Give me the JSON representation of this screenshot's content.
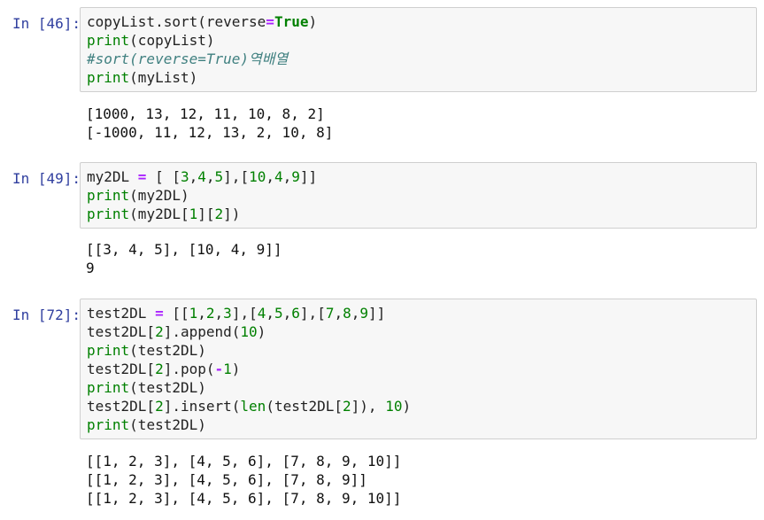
{
  "cells": [
    {
      "prompt": "In [46]:",
      "code": [
        [
          {
            "t": "copyList.sort(reverse"
          },
          {
            "t": "=",
            "c": "op"
          },
          {
            "t": "True",
            "c": "kw"
          },
          {
            "t": ")"
          }
        ],
        [
          {
            "t": "print",
            "c": "bi"
          },
          {
            "t": "(copyList)"
          }
        ],
        [
          {
            "t": "#sort(reverse=True)역배열",
            "c": "cm"
          }
        ],
        [
          {
            "t": "print",
            "c": "bi"
          },
          {
            "t": "(myList)"
          }
        ]
      ],
      "output": [
        "[1000, 13, 12, 11, 10, 8, 2]",
        "[-1000, 11, 12, 13, 2, 10, 8]"
      ]
    },
    {
      "prompt": "In [49]:",
      "code": [
        [
          {
            "t": "my2DL "
          },
          {
            "t": "=",
            "c": "op"
          },
          {
            "t": " [ ["
          },
          {
            "t": "3",
            "c": "num"
          },
          {
            "t": ","
          },
          {
            "t": "4",
            "c": "num"
          },
          {
            "t": ","
          },
          {
            "t": "5",
            "c": "num"
          },
          {
            "t": "],["
          },
          {
            "t": "10",
            "c": "num"
          },
          {
            "t": ","
          },
          {
            "t": "4",
            "c": "num"
          },
          {
            "t": ","
          },
          {
            "t": "9",
            "c": "num"
          },
          {
            "t": "]]"
          }
        ],
        [
          {
            "t": "print",
            "c": "bi"
          },
          {
            "t": "(my2DL)"
          }
        ],
        [
          {
            "t": "print",
            "c": "bi"
          },
          {
            "t": "(my2DL["
          },
          {
            "t": "1",
            "c": "num"
          },
          {
            "t": "]["
          },
          {
            "t": "2",
            "c": "num"
          },
          {
            "t": "])"
          }
        ]
      ],
      "output": [
        "[[3, 4, 5], [10, 4, 9]]",
        "9"
      ]
    },
    {
      "prompt": "In [72]:",
      "code": [
        [
          {
            "t": "test2DL "
          },
          {
            "t": "=",
            "c": "op"
          },
          {
            "t": " [["
          },
          {
            "t": "1",
            "c": "num"
          },
          {
            "t": ","
          },
          {
            "t": "2",
            "c": "num"
          },
          {
            "t": ","
          },
          {
            "t": "3",
            "c": "num"
          },
          {
            "t": "],["
          },
          {
            "t": "4",
            "c": "num"
          },
          {
            "t": ","
          },
          {
            "t": "5",
            "c": "num"
          },
          {
            "t": ","
          },
          {
            "t": "6",
            "c": "num"
          },
          {
            "t": "],["
          },
          {
            "t": "7",
            "c": "num"
          },
          {
            "t": ","
          },
          {
            "t": "8",
            "c": "num"
          },
          {
            "t": ","
          },
          {
            "t": "9",
            "c": "num"
          },
          {
            "t": "]]"
          }
        ],
        [
          {
            "t": "test2DL["
          },
          {
            "t": "2",
            "c": "num"
          },
          {
            "t": "].append("
          },
          {
            "t": "10",
            "c": "num"
          },
          {
            "t": ")"
          }
        ],
        [
          {
            "t": "print",
            "c": "bi"
          },
          {
            "t": "(test2DL)"
          }
        ],
        [
          {
            "t": "test2DL["
          },
          {
            "t": "2",
            "c": "num"
          },
          {
            "t": "].pop("
          },
          {
            "t": "-",
            "c": "op"
          },
          {
            "t": "1",
            "c": "num"
          },
          {
            "t": ")"
          }
        ],
        [
          {
            "t": "print",
            "c": "bi"
          },
          {
            "t": "(test2DL)"
          }
        ],
        [
          {
            "t": "test2DL["
          },
          {
            "t": "2",
            "c": "num"
          },
          {
            "t": "].insert("
          },
          {
            "t": "len",
            "c": "bi"
          },
          {
            "t": "(test2DL["
          },
          {
            "t": "2",
            "c": "num"
          },
          {
            "t": "]), "
          },
          {
            "t": "10",
            "c": "num"
          },
          {
            "t": ")"
          }
        ],
        [
          {
            "t": "print",
            "c": "bi"
          },
          {
            "t": "(test2DL)"
          }
        ]
      ],
      "output": [
        "[[1, 2, 3], [4, 5, 6], [7, 8, 9, 10]]",
        "[[1, 2, 3], [4, 5, 6], [7, 8, 9]]",
        "[[1, 2, 3], [4, 5, 6], [7, 8, 9, 10]]"
      ]
    }
  ]
}
